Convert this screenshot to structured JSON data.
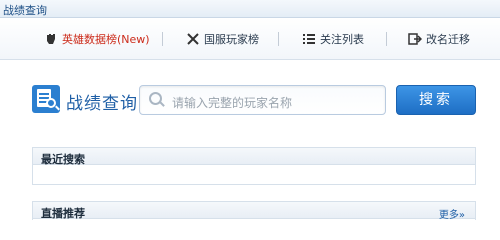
{
  "window": {
    "title": "战绩查询"
  },
  "nav": {
    "items": [
      {
        "label": "英雄数据榜(New)",
        "icon": "fist-icon",
        "hot": true
      },
      {
        "label": "国服玩家榜",
        "icon": "crossed-swords-icon"
      },
      {
        "label": "关注列表",
        "icon": "list-icon"
      },
      {
        "label": "改名迁移",
        "icon": "transfer-icon"
      }
    ]
  },
  "search": {
    "title": "战绩查询",
    "placeholder": "请输入完整的玩家名称",
    "button_label": "搜索"
  },
  "recent": {
    "label": "最近搜索"
  },
  "live": {
    "label": "直播推荐",
    "more_label": "更多»"
  },
  "colors": {
    "accent": "#2b7fd0",
    "hot": "#cc2b1a"
  }
}
